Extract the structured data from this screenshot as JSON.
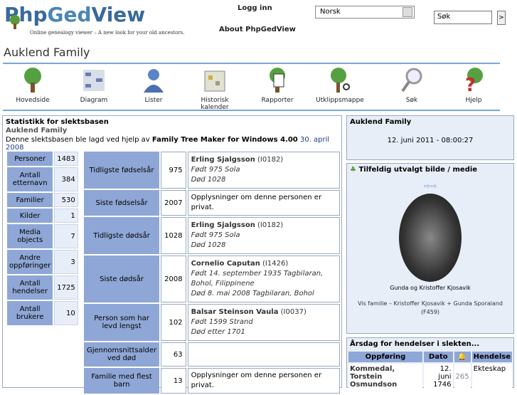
{
  "header": {
    "logo_text_a": "Php",
    "logo_text_b": "Ged",
    "logo_text_c": "View",
    "tagline": "Online genealogy viewer – A new look for your old ancestors.",
    "login": "Logg inn",
    "about": "About PhpGedView",
    "language": "Norsk",
    "search_placeholder": "Søk",
    "search_go": ">"
  },
  "page_title": "Auklend Family",
  "nav": [
    {
      "label": "Hovedside",
      "icon": "tree-icon"
    },
    {
      "label": "Diagram",
      "icon": "chart-icon"
    },
    {
      "label": "Lister",
      "icon": "person-icon"
    },
    {
      "label": "Historisk kalender",
      "icon": "calendar-icon"
    },
    {
      "label": "Rapporter",
      "icon": "report-icon"
    },
    {
      "label": "Utklippsmappe",
      "icon": "clippings-icon"
    },
    {
      "label": "Søk",
      "icon": "magnifier-icon"
    },
    {
      "label": "Hjelp",
      "icon": "help-icon"
    }
  ],
  "stats": {
    "heading": "Statistikk for slektsbasen",
    "family": "Auklend Family",
    "built_prefix": "Denne slektsbasen ble lagd ved hjelp av ",
    "built_software": "Family Tree Maker for Windows 4.00",
    "built_date": "30. april 2008",
    "counts": [
      {
        "label": "Personer",
        "value": "1483"
      },
      {
        "label": "Antall etternavn",
        "value": "384"
      },
      {
        "label": "Familier",
        "value": "530"
      },
      {
        "label": "Kilder",
        "value": "1"
      },
      {
        "label": "Media objects",
        "value": "7"
      },
      {
        "label": "Andre oppføringer",
        "value": "3"
      },
      {
        "label": "Antall hendelser",
        "value": "1725"
      },
      {
        "label": "Antall brukere",
        "value": "10"
      }
    ],
    "facts": [
      {
        "label": "Tidligste fødselsår",
        "num": "975",
        "name": "Erling Sjalgsson",
        "id": "(I0182)",
        "l1": "Født 975 Sola",
        "l2": "Død 1028"
      },
      {
        "label": "Siste fødselsår",
        "num": "2007",
        "private": "Opplysninger om denne personen er privat."
      },
      {
        "label": "Tidligste dødsår",
        "num": "1028",
        "name": "Erling Sjalgsson",
        "id": "(I0182)",
        "l1": "Født 975 Sola",
        "l2": "Død 1028"
      },
      {
        "label": "Siste dødsår",
        "num": "2008",
        "name": "Cornelio Caputan",
        "id": "(I1426)",
        "l1": "Født 14. september 1935 Tagbilaran, Bohol, Filippinene",
        "l2": "Død 8. mai 2008 Tagbilaran, Bohol"
      },
      {
        "label": "Person som har levd lengst",
        "num": "102",
        "name": "Balsar Steinson Vaula",
        "id": "(I0037)",
        "l1": "Født 1599 Strand",
        "l2": "Død etter 1701"
      },
      {
        "label": "Gjennomsnittsalder ved død",
        "num": "63",
        "name": "",
        "id": "",
        "l1": "",
        "l2": ""
      },
      {
        "label": "Familie med flest barn",
        "num": "13",
        "private": "Opplysninger om denne personen er privat."
      }
    ]
  },
  "right": {
    "family": "Auklend Family",
    "datetime": "12. juni 2011 - 08:00:27",
    "media_title": "Tilfeldig utvalgt bilde / medie",
    "media_caption": "Gunda og Kristoffer Kjosavik",
    "media_sub": "Vis familie – Kristoffer Kjosavik + Gunda Sporaland (F459)",
    "anniv_title": "Årsdag for hendelser i slekten...",
    "anniv_headers": [
      "Oppføring",
      "Dato",
      "",
      "Hendelse"
    ],
    "anniv_row": {
      "name": "Kommedal, Torstein Osmundson",
      "date": "12. juni 1746",
      "years": "265",
      "event": "Ekteskap"
    }
  }
}
